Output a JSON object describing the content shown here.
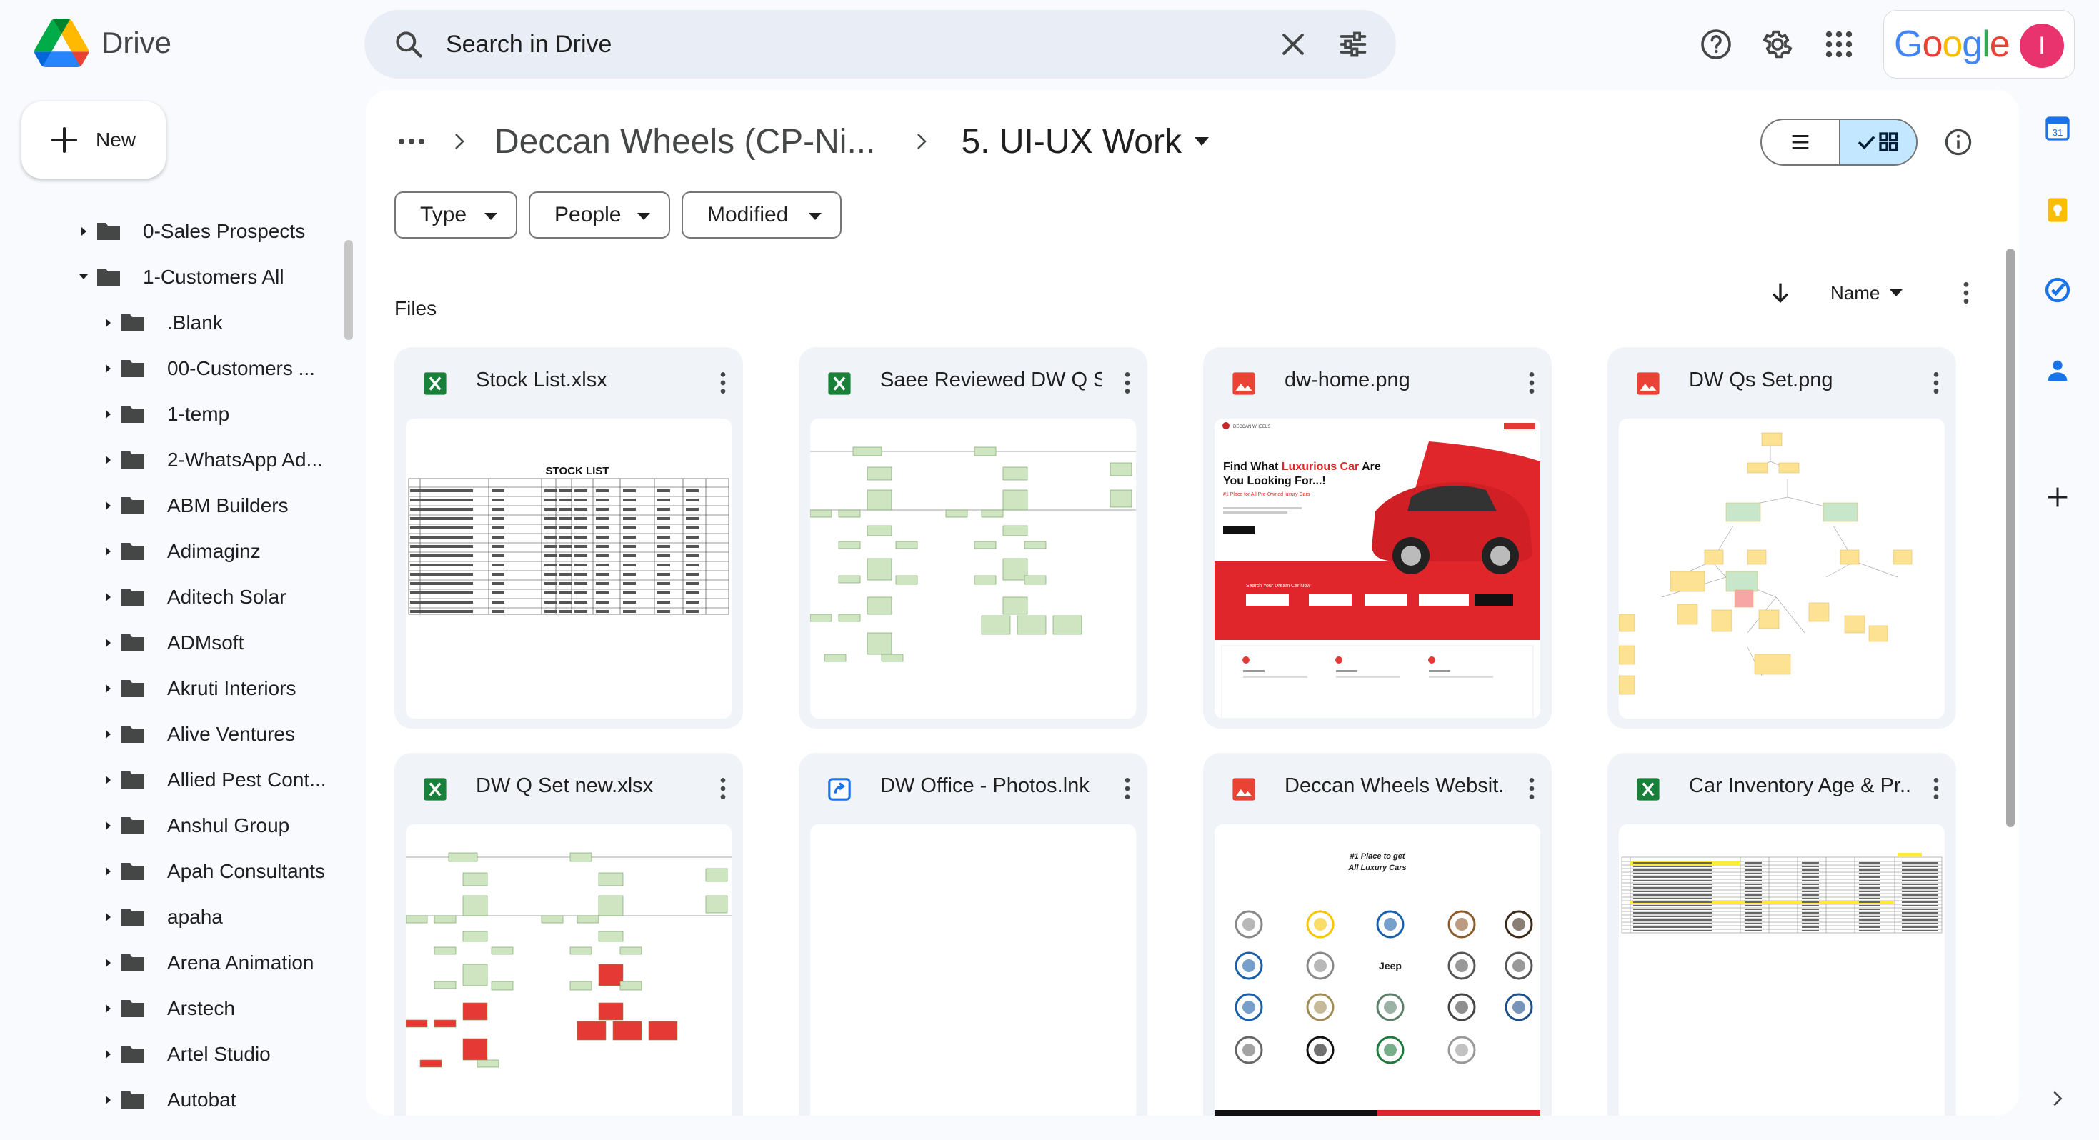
{
  "app": {
    "name": "Drive"
  },
  "search": {
    "placeholder": "Search in Drive"
  },
  "header": {
    "google_word": "Google",
    "avatar_letter": "I"
  },
  "sidebar": {
    "new_label": "New",
    "tree": [
      {
        "label": "0-Sales Prospects",
        "level": 0,
        "expanded": false
      },
      {
        "label": "1-Customers All",
        "level": 0,
        "expanded": true
      },
      {
        "label": ".Blank",
        "level": 1,
        "expanded": false
      },
      {
        "label": "00-Customers ...",
        "level": 1,
        "expanded": false
      },
      {
        "label": "1-temp",
        "level": 1,
        "expanded": false
      },
      {
        "label": "2-WhatsApp Ad...",
        "level": 1,
        "expanded": false
      },
      {
        "label": "ABM Builders",
        "level": 1,
        "expanded": false
      },
      {
        "label": "Adimaginz",
        "level": 1,
        "expanded": false
      },
      {
        "label": "Aditech Solar",
        "level": 1,
        "expanded": false
      },
      {
        "label": "ADMsoft",
        "level": 1,
        "expanded": false
      },
      {
        "label": "Akruti Interiors",
        "level": 1,
        "expanded": false
      },
      {
        "label": "Alive Ventures",
        "level": 1,
        "expanded": false
      },
      {
        "label": "Allied Pest Cont...",
        "level": 1,
        "expanded": false
      },
      {
        "label": "Anshul Group",
        "level": 1,
        "expanded": false
      },
      {
        "label": "Apah Consultants",
        "level": 1,
        "expanded": false
      },
      {
        "label": "apaha",
        "level": 1,
        "expanded": false
      },
      {
        "label": "Arena Animation",
        "level": 1,
        "expanded": false
      },
      {
        "label": "Arstech",
        "level": 1,
        "expanded": false
      },
      {
        "label": "Artel Studio",
        "level": 1,
        "expanded": false
      },
      {
        "label": "Autobat",
        "level": 1,
        "expanded": false
      }
    ]
  },
  "breadcrumb": {
    "parent": "Deccan Wheels (CP-Ni...",
    "current": "5. UI-UX Work"
  },
  "filters": {
    "type": "Type",
    "people": "People",
    "modified": "Modified"
  },
  "files_section": {
    "label": "Files",
    "sort_label": "Name"
  },
  "files": [
    {
      "name": "Stock List.xlsx",
      "kind": "xlsx",
      "thumb": "stock-list"
    },
    {
      "name": "Saee Reviewed DW Q S...",
      "kind": "xlsx",
      "thumb": "flowchart"
    },
    {
      "name": "dw-home.png",
      "kind": "image",
      "thumb": "car-hero"
    },
    {
      "name": "DW Qs Set.png",
      "kind": "image",
      "thumb": "yellow-flow"
    },
    {
      "name": "DW Q Set new.xlsx",
      "kind": "xlsx",
      "thumb": "flowchart-red"
    },
    {
      "name": "DW Office - Photos.lnk",
      "kind": "shortcut",
      "thumb": "blank"
    },
    {
      "name": "Deccan Wheels Websit...",
      "kind": "image",
      "thumb": "brands"
    },
    {
      "name": "Car Inventory Age & Pr...",
      "kind": "xlsx",
      "thumb": "inventory"
    }
  ],
  "thumbnails": {
    "stock_list_title": "STOCK  LIST",
    "car_hero_brand": "DECCAN WHEELS",
    "car_hero_heading_1": "Find What ",
    "car_hero_heading_highlight": "Luxurious Car",
    "car_hero_heading_2": " Are",
    "car_hero_heading_3": "You Looking For...!",
    "car_hero_sub": "#1 Place for All Pre-Owned luxury Cars",
    "car_hero_search": "Search Your Dream Car Now",
    "brands_heading_1": "#1 Place to get",
    "brands_heading_2": "All Luxury Cars",
    "brands_jeep": "Jeep"
  },
  "colors": {
    "sheets_green": "#188038",
    "image_red": "#ea4335",
    "shortcut_blue": "#1a73e8",
    "selected_toggle": "#c2e7ff",
    "avatar": "#e8336e"
  }
}
